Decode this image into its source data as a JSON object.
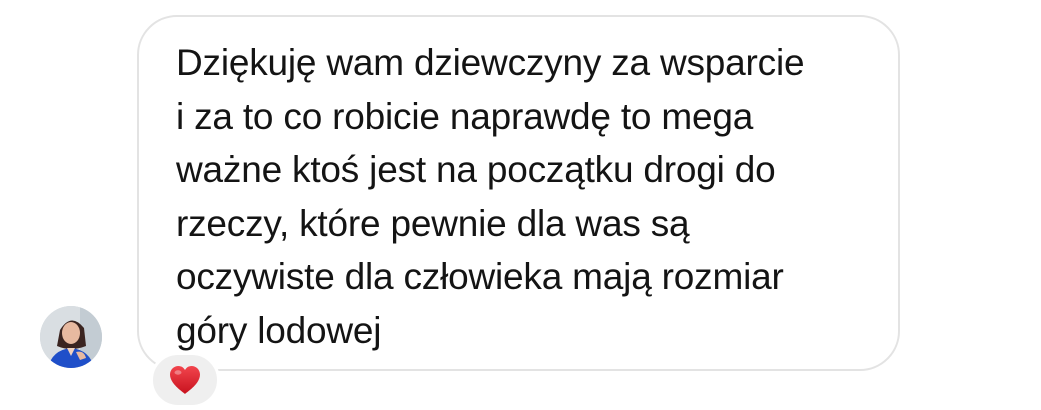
{
  "message": {
    "text": "Dziękuję wam dziewczyny za wsparcie\ni za to co robicie naprawdę to mega\nważne ktoś jest na początku drogi do\nrzeczy, które pewnie dla was są\noczywiste dla człowieka mają rozmiar\ngóry lodowej"
  },
  "reaction": {
    "emoji": "heart-icon",
    "color": "#e0242f"
  },
  "colors": {
    "bubble_border": "#e3e3e3",
    "text": "#141414",
    "reaction_bg": "#efefef"
  }
}
